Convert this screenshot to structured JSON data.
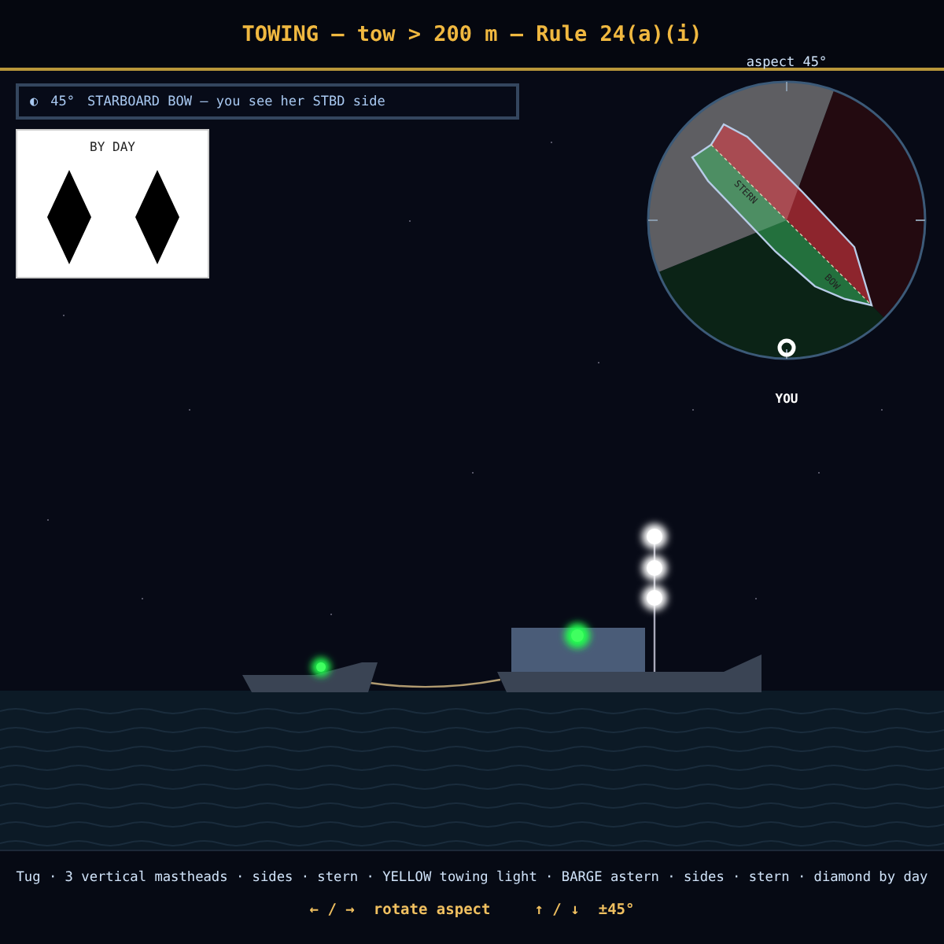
{
  "header": {
    "title": "TOWING — tow > 200 m — Rule 24(a)(i)"
  },
  "aspect_bar": {
    "icon": "◐",
    "angle": "45°",
    "text": "STARBOARD BOW — you see her STBD side"
  },
  "day_shape": {
    "title": "BY DAY",
    "shapes": [
      {
        "kind": "diamond"
      },
      {
        "kind": "diamond"
      }
    ]
  },
  "dial": {
    "label": "aspect 45°",
    "stern_label": "STERN",
    "bow_label": "BOW",
    "observer_label": "YOU"
  },
  "legend": {
    "text": "Tug · 3 vertical mastheads · sides · stern · YELLOW towing light · BARGE astern · sides · stern · diamond by day"
  },
  "keys": [
    {
      "keys": "← / →",
      "action": "rotate aspect"
    },
    {
      "keys": "↑ / ↓",
      "action": "±45°"
    }
  ]
}
